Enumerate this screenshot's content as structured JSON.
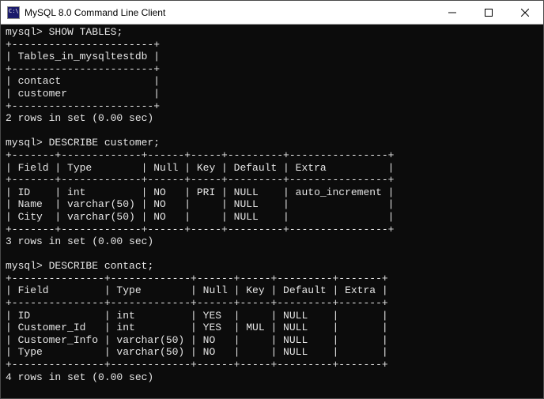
{
  "window": {
    "title": "MySQL 8.0 Command Line Client"
  },
  "session": {
    "prompt": "mysql>",
    "cmd1": "SHOW TABLES;",
    "cmd2": "DESCRIBE customer;",
    "cmd3": "DESCRIBE contact;",
    "status1": "2 rows in set (0.00 sec)",
    "status2": "3 rows in set (0.00 sec)",
    "status3": "4 rows in set (0.00 sec)",
    "tables_border": "+-----------------------+",
    "tables_header": "| Tables_in_mysqltestdb |",
    "tables_row1": "| contact               |",
    "tables_row2": "| customer              |",
    "customer_border": "+-------+-------------+------+-----+---------+----------------+",
    "customer_header": "| Field | Type        | Null | Key | Default | Extra          |",
    "customer_row1": "| ID    | int         | NO   | PRI | NULL    | auto_increment |",
    "customer_row2": "| Name  | varchar(50) | NO   |     | NULL    |                |",
    "customer_row3": "| City  | varchar(50) | NO   |     | NULL    |                |",
    "contact_border": "+---------------+-------------+------+-----+---------+-------+",
    "contact_header": "| Field         | Type        | Null | Key | Default | Extra |",
    "contact_row1": "| ID            | int         | YES  |     | NULL    |       |",
    "contact_row2": "| Customer_Id   | int         | YES  | MUL | NULL    |       |",
    "contact_row3": "| Customer_Info | varchar(50) | NO   |     | NULL    |       |",
    "contact_row4": "| Type          | varchar(50) | NO   |     | NULL    |       |"
  },
  "chart_data": {
    "type": "table",
    "tables": [
      {
        "title": "Tables_in_mysqltestdb",
        "rows": [
          "contact",
          "customer"
        ]
      },
      {
        "title": "DESCRIBE customer",
        "columns": [
          "Field",
          "Type",
          "Null",
          "Key",
          "Default",
          "Extra"
        ],
        "rows": [
          [
            "ID",
            "int",
            "NO",
            "PRI",
            "NULL",
            "auto_increment"
          ],
          [
            "Name",
            "varchar(50)",
            "NO",
            "",
            "NULL",
            ""
          ],
          [
            "City",
            "varchar(50)",
            "NO",
            "",
            "NULL",
            ""
          ]
        ]
      },
      {
        "title": "DESCRIBE contact",
        "columns": [
          "Field",
          "Type",
          "Null",
          "Key",
          "Default",
          "Extra"
        ],
        "rows": [
          [
            "ID",
            "int",
            "YES",
            "",
            "NULL",
            ""
          ],
          [
            "Customer_Id",
            "int",
            "YES",
            "MUL",
            "NULL",
            ""
          ],
          [
            "Customer_Info",
            "varchar(50)",
            "NO",
            "",
            "NULL",
            ""
          ],
          [
            "Type",
            "varchar(50)",
            "NO",
            "",
            "NULL",
            ""
          ]
        ]
      }
    ]
  }
}
